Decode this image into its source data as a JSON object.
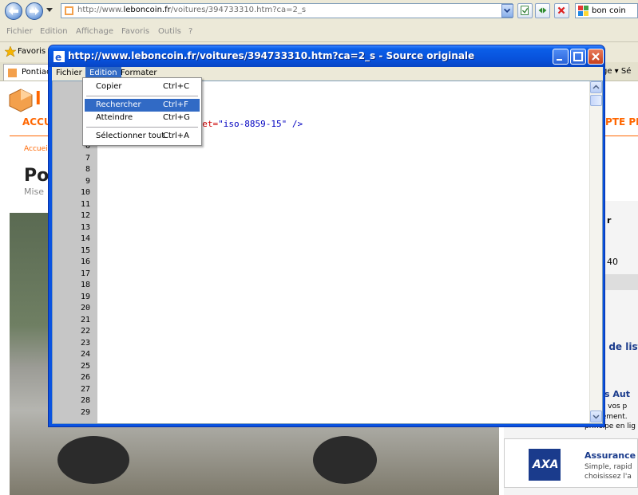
{
  "browser": {
    "url_prefix": "http://www.",
    "url_host": "leboncoin.fr",
    "url_path": "/voitures/394733310.htm?ca=2_s",
    "search_text": "bon coin",
    "menu": [
      "Fichier",
      "Edition",
      "Affichage",
      "Favoris",
      "Outils",
      "?"
    ],
    "favorites_label": "Favoris",
    "tab_label": "Pontiac",
    "tab_right": "ge ▾  Sé"
  },
  "page": {
    "acc": "ACCU",
    "acc_right": "PTE PR",
    "accueil": "Accuei",
    "title_partial": "Po",
    "mise": "Mise",
    "side_r": "r",
    "side_40": "40",
    "side_list": "e de list",
    "side_autos": "its Aut",
    "side_l1": "ez vos p",
    "side_l2": "gement.",
    "side_l3": "principe en lig",
    "axa": "AXA",
    "assurance": "Assurance ",
    "simple": "Simple, rapid",
    "choisissez": "choisissez l'a"
  },
  "source_window": {
    "title": "http://www.leboncoin.fr/voitures/394733310.htm?ca=2_s - Source originale",
    "menus": [
      "Fichier",
      "Edition",
      "Formater"
    ],
    "code_attr": "rset=",
    "code_val": "\"iso-8859-15\" />",
    "line_numbers": [
      "6",
      "7",
      "8",
      "9",
      "10",
      "11",
      "12",
      "13",
      "14",
      "15",
      "16",
      "17",
      "18",
      "19",
      "20",
      "21",
      "22",
      "23",
      "24",
      "25",
      "26",
      "27",
      "28",
      "29"
    ]
  },
  "edition_menu": {
    "items": [
      {
        "label": "Copier",
        "shortcut": "Ctrl+C"
      },
      {
        "label": "Rechercher",
        "shortcut": "Ctrl+F"
      },
      {
        "label": "Atteindre",
        "shortcut": "Ctrl+G"
      },
      {
        "label": "Sélectionner tout",
        "shortcut": "Ctrl+A"
      }
    ],
    "highlighted": "Rechercher"
  },
  "colors": {
    "xp_blue": "#0a53e0",
    "menu_highlight": "#316ac5",
    "leboncoin_orange": "#ff6600"
  }
}
